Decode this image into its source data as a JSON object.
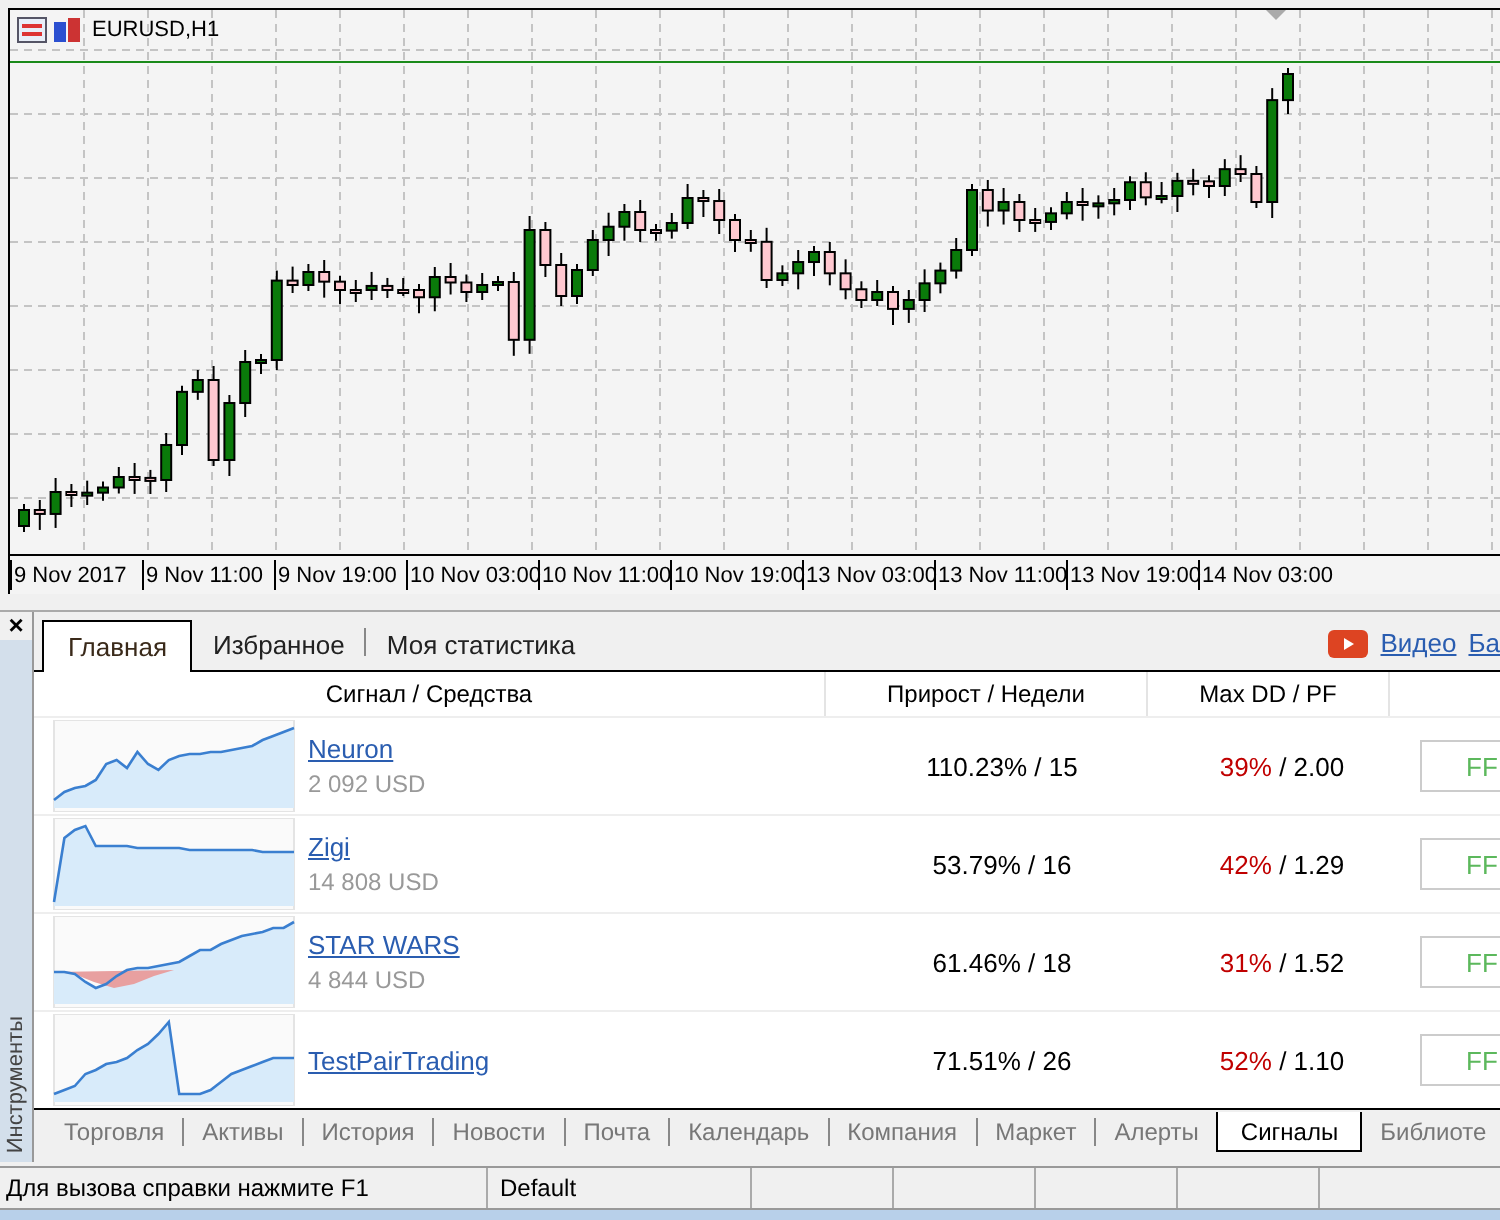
{
  "chart": {
    "title": "EURUSD,H1",
    "x_labels": [
      "9 Nov 2017",
      "9 Nov 11:00",
      "9 Nov 19:00",
      "10 Nov 03:00",
      "10 Nov 11:00",
      "10 Nov 19:00",
      "13 Nov 03:00",
      "13 Nov 11:00",
      "13 Nov 19:00",
      "14 Nov 03:00"
    ]
  },
  "side_panel": {
    "label": "Инструменты",
    "close": "×"
  },
  "tabs": [
    {
      "label": "Главная",
      "selected": true
    },
    {
      "label": "Избранное",
      "selected": false
    },
    {
      "label": "Моя статистика",
      "selected": false
    }
  ],
  "links": [
    {
      "kind": "video",
      "label": "Видео"
    },
    {
      "kind": "plain",
      "label": "Ба"
    }
  ],
  "table": {
    "columns": [
      "Сигнал / Средства",
      "Прирост / Недели",
      "Max DD / PF"
    ],
    "rows": [
      {
        "name": "Neuron",
        "balance": "2 092 USD",
        "growth": "110.23% / 15",
        "dd": "39%",
        "pf": "/ 2.00",
        "button": "FF"
      },
      {
        "name": "Zigi",
        "balance": "14 808 USD",
        "growth": "53.79% / 16",
        "dd": "42%",
        "pf": "/ 1.29",
        "button": "FF"
      },
      {
        "name": "STAR WARS",
        "balance": "4 844 USD",
        "growth": "61.46% / 18",
        "dd": "31%",
        "pf": "/ 1.52",
        "button": "FF"
      },
      {
        "name": "TestPairTrading",
        "growth": "71.51% / 26",
        "dd": "52%",
        "pf": "/ 1.10",
        "button": "FF"
      }
    ]
  },
  "bottom_tabs": [
    {
      "label": "Торговля",
      "selected": false
    },
    {
      "label": "Активы",
      "selected": false
    },
    {
      "label": "История",
      "selected": false
    },
    {
      "label": "Новости",
      "selected": false
    },
    {
      "label": "Почта",
      "selected": false
    },
    {
      "label": "Календарь",
      "selected": false
    },
    {
      "label": "Компания",
      "selected": false
    },
    {
      "label": "Маркет",
      "selected": false
    },
    {
      "label": "Алерты",
      "selected": false
    },
    {
      "label": "Сигналы",
      "selected": true
    },
    {
      "label": "Библиоте",
      "selected": false
    }
  ],
  "status_bar": [
    "Для вызова справки нажмите F1",
    "Default"
  ]
}
